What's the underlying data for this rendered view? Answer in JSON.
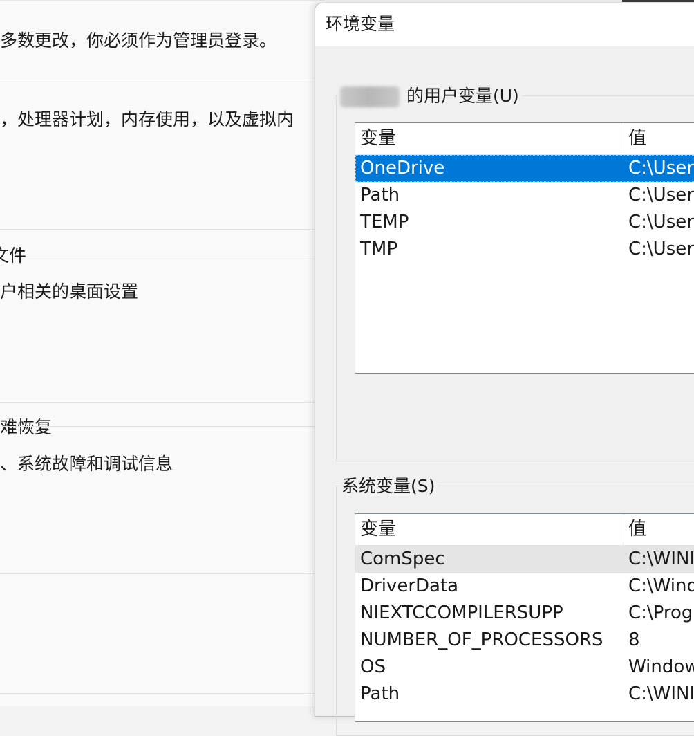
{
  "background_window": {
    "lines": [
      "多数更改，你必须作为管理员登录。",
      "，处理器计划，内存使用，以及虚拟内",
      "文件",
      "户相关的桌面设置",
      "灾难恢复",
      "、系统故障和调试信息"
    ]
  },
  "dialog": {
    "title": "环境变量",
    "user_vars": {
      "caption": "的用户变量(U)",
      "headers": {
        "name": "变量",
        "value": "值"
      },
      "rows": [
        {
          "name": "OneDrive",
          "value": "C:\\Users",
          "selected": true
        },
        {
          "name": "Path",
          "value": "C:\\Users"
        },
        {
          "name": "TEMP",
          "value": "C:\\Users"
        },
        {
          "name": "TMP",
          "value": "C:\\Users"
        }
      ]
    },
    "system_vars": {
      "caption": "系统变量(S)",
      "headers": {
        "name": "变量",
        "value": "值"
      },
      "rows": [
        {
          "name": "ComSpec",
          "value": "C:\\WINI"
        },
        {
          "name": "DriverData",
          "value": "C:\\Wind"
        },
        {
          "name": "NIEXTCCOMPILERSUPP",
          "value": "C:\\Prog"
        },
        {
          "name": "NUMBER_OF_PROCESSORS",
          "value": "8"
        },
        {
          "name": "OS",
          "value": "Window"
        },
        {
          "name": "Path",
          "value": "C:\\WINI"
        }
      ]
    }
  },
  "colors": {
    "selection": "#0078d7",
    "hover_row": "#e5e5e5",
    "dialog_bg": "#f0f0f0"
  }
}
